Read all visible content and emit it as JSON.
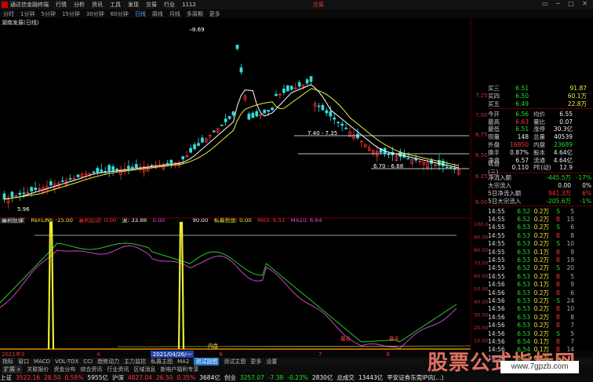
{
  "titlebar": {
    "app": "通达信金融终端",
    "menus": [
      "行情",
      "分析",
      "资讯",
      "工具",
      "发现",
      "交易",
      "行业",
      "1112"
    ],
    "right": "交易"
  },
  "periods": [
    "分时",
    "1分钟",
    "5分钟",
    "15分钟",
    "30分钟",
    "60分钟",
    "日线",
    "周线",
    "月线",
    "多周期",
    "更多"
  ],
  "stock_name": "湖南发展(日线)",
  "price_axis": [
    "7.25",
    "7.00",
    "6.75",
    "6.50",
    "6.25",
    "6.00"
  ],
  "annotations": {
    "high": "9.69",
    "low": "5.96",
    "range1": "7.40 - 7.35",
    "range2": "6.70 - 6.68"
  },
  "indicator": {
    "header": [
      {
        "text": "REFLINE -15.00",
        "color": "yellow"
      },
      {
        "text": "暴利启动: 0.00",
        "color": "red"
      },
      {
        "text": "波: 33.88",
        "color": "white"
      },
      {
        "text": "0.00",
        "color": "mag"
      },
      {
        "text": "90.00",
        "color": "white"
      },
      {
        "text": "私募抢盘: 0.00",
        "color": "yellow"
      },
      {
        "text": "MA5: 6.51",
        "color": "red"
      },
      {
        "text": "MA10: 6.64",
        "color": "mag"
      }
    ],
    "tab": "暴利狂弹",
    "axis": [
      "100.00",
      "90.00",
      "80.00",
      "70.00",
      "60.00",
      "50.00",
      "40.00",
      "30.00",
      "20.00",
      "10.00"
    ],
    "inner_label": "内盘",
    "mark1": "暴击",
    "mark2": "暴击"
  },
  "timeline": {
    "left": "2021年3",
    "ticks": [
      "4",
      "2021/04/26/一",
      "6",
      "7",
      "8",
      "9"
    ]
  },
  "tabs1": [
    "指标",
    "窗口",
    "MACD",
    "VOL-TDX",
    "CCI",
    "趋势动力",
    "主力监控",
    "私募主图",
    "MA2",
    "测试副图",
    "测试主图",
    "更多",
    "设置"
  ],
  "tabs2": [
    "扩展 ∧",
    "关联报价",
    "资金分布",
    "综合资讯",
    "行业资讯",
    "区域消息",
    "新电户福利专享"
  ],
  "status": {
    "sh_label": "上证",
    "sh_val": "3522.16",
    "sh_chg": "28.50",
    "sh_pct": "0.59%",
    "sh_amt": "5955亿",
    "sz_label": "沪深",
    "sz_val": "4827.04",
    "sz_chg": "26.50",
    "sz_pct": "0.35%",
    "sz_amt": "3684亿",
    "cy_label": "创业",
    "cy_val": "3257.07",
    "cy_chg": "-7.38",
    "cy_pct": "-0.23%",
    "cy_amt": "2830亿",
    "total_label": "总成交",
    "total": "13443亿",
    "news": "平安证券东莞IP讯(...)"
  },
  "quotes": [
    {
      "l": "买三",
      "v": "6.51",
      "v2": "",
      "v3": "91.87"
    },
    {
      "l": "买四",
      "v": "6.50",
      "v2": "",
      "v3": "60.1万"
    },
    {
      "l": "买五",
      "v": "6.49",
      "v2": "",
      "v3": "22.8万"
    }
  ],
  "stats": [
    {
      "l": "今开",
      "v": "6.56",
      "l2": "均价",
      "v3": "6.55"
    },
    {
      "l": "最高",
      "v": "6.63",
      "l2": "量比",
      "v3": "0.07"
    },
    {
      "l": "最低",
      "v": "6.51",
      "l2": "涨停",
      "v3": "30.3亿"
    },
    {
      "l": "现量",
      "v": "148",
      "l2": "总量",
      "v3": "40539"
    },
    {
      "l": "外盘",
      "v": "16850",
      "l2": "内盘",
      "v3": "23689"
    },
    {
      "l": "换手",
      "v": "0.87%",
      "l2": "股本",
      "v3": "4.64亿"
    },
    {
      "l": "净资",
      "v": "6.57",
      "l2": "流通",
      "v3": "4.64亿"
    },
    {
      "l": "收益(三)",
      "v": "0.110",
      "l2": "PE(动)",
      "v3": "12.9"
    }
  ],
  "flows": [
    {
      "l": "净流入额",
      "v": "-445.5万",
      "p": "-17%",
      "c": "green"
    },
    {
      "l": "大宗流入",
      "v": "0.00",
      "p": "0%",
      "c": "white"
    },
    {
      "l": "5日净流入额",
      "v": "941.3万",
      "p": "6%",
      "c": "red"
    },
    {
      "l": "5日大宗流入",
      "v": "-205.6万",
      "p": "-1%",
      "c": "green"
    }
  ],
  "ticks": [
    {
      "t": "14:55",
      "p": "6.52",
      "v": "0.2万",
      "b": "S",
      "n": "5"
    },
    {
      "t": "14:55",
      "p": "6.52",
      "v": "0.2万",
      "b": "B",
      "n": "15"
    },
    {
      "t": "14:55",
      "p": "6.53",
      "v": "0.2万",
      "b": "S",
      "n": "6"
    },
    {
      "t": "14:55",
      "p": "6.53",
      "v": "0.2万",
      "b": "B",
      "n": "8"
    },
    {
      "t": "14:55",
      "p": "6.53",
      "v": "0.2万",
      "b": "S",
      "n": "10"
    },
    {
      "t": "14:55",
      "p": "6.53",
      "v": "0.1万",
      "b": "B",
      "n": "9"
    },
    {
      "t": "14:55",
      "p": "6.53",
      "v": "0.2万",
      "b": "B",
      "n": "19"
    },
    {
      "t": "14:55",
      "p": "6.52",
      "v": "0.2万",
      "b": "S",
      "n": "20"
    },
    {
      "t": "14:55",
      "p": "6.53",
      "v": "0.2万",
      "b": "B",
      "n": "5"
    },
    {
      "t": "14:56",
      "p": "6.53",
      "v": "0.1万",
      "b": "B",
      "n": "9"
    },
    {
      "t": "14:56",
      "p": "6.53",
      "v": "0.2万",
      "b": "B",
      "n": "6"
    },
    {
      "t": "14:56",
      "p": "6.53",
      "v": "0.2万",
      "b": "S",
      "n": "24"
    },
    {
      "t": "14:56",
      "p": "6.53",
      "v": "0.2万",
      "b": "B",
      "n": "10"
    },
    {
      "t": "14:56",
      "p": "6.53",
      "v": "0.2万",
      "b": "B",
      "n": "8"
    },
    {
      "t": "14:56",
      "p": "6.53",
      "v": "0.2万",
      "b": "B",
      "n": "7"
    },
    {
      "t": "14:56",
      "p": "6.53",
      "v": "0.2万",
      "b": "S",
      "n": "5"
    },
    {
      "t": "14:56",
      "p": "6.54",
      "v": "0.1万",
      "b": "B",
      "n": "7"
    },
    {
      "t": "14:56",
      "p": "6.54",
      "v": "0.1万",
      "b": "B",
      "n": "14"
    },
    {
      "t": "14:56",
      "p": "6.53",
      "v": "0.2万",
      "b": "S",
      "n": "5"
    }
  ],
  "watermark": {
    "big": "股票公式指标网",
    "url": "www.7gpzb.com"
  },
  "colors": {
    "up": "#ff3333",
    "down": "#22dd22",
    "ma5": "#ffffff",
    "ma10": "#ffff33"
  }
}
